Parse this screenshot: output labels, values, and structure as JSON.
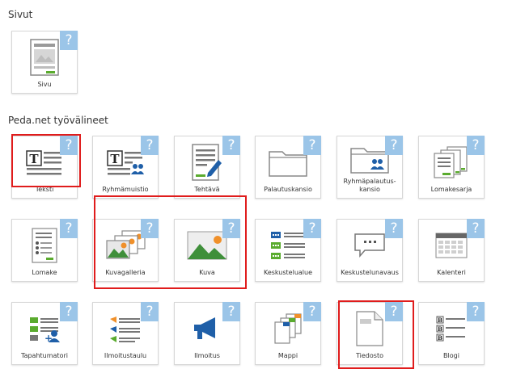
{
  "sections": {
    "pages_title": "Sivut",
    "tools_title": "Peda.net työvälineet"
  },
  "help_glyph": "?",
  "tiles": {
    "sivu": "Sivu",
    "teksti": "Teksti",
    "ryhmamuistio": "Ryhmämuistio",
    "tehtava": "Tehtävä",
    "palautuskansio": "Palautuskansio",
    "ryhmapalautuskansio": "Ryhmäpalautus-\nkansio",
    "lomakesarja": "Lomakesarja",
    "lomake": "Lomake",
    "kuvagalleria": "Kuvagalleria",
    "kuva": "Kuva",
    "keskustelualue": "Keskustelualue",
    "keskustelunavaus": "Keskustelunavaus",
    "kalenteri": "Kalenteri",
    "tapahtumatori": "Tapahtumatori",
    "ilmoitustaulu": "Ilmoitustaulu",
    "ilmoitus": "Ilmoitus",
    "mappi": "Mappi",
    "tiedosto": "Tiedosto",
    "blogi": "Blogi"
  },
  "colors": {
    "help_badge": "#9bc5e8",
    "highlight": "#e01c1c",
    "accent_green": "#5aab2e",
    "accent_blue": "#1f5fa8",
    "accent_orange": "#f0902a"
  }
}
